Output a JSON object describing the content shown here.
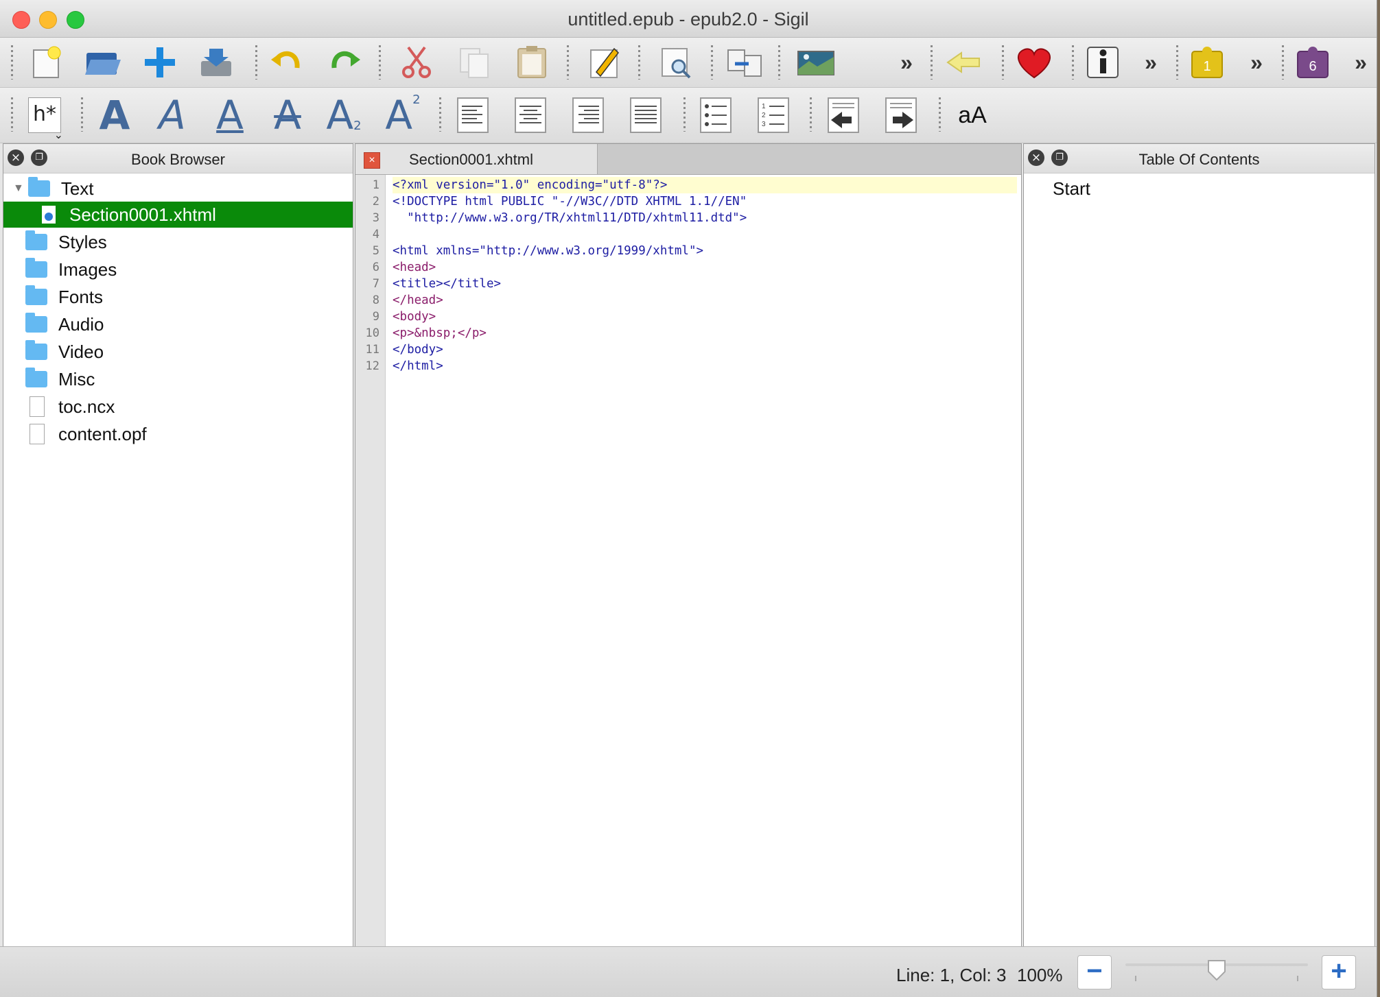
{
  "window": {
    "title": "untitled.epub - epub2.0 - Sigil"
  },
  "toolbar_main": {
    "icons": [
      "new-file-icon",
      "open-folder-icon",
      "add-plus-icon",
      "save-icon",
      "undo-icon",
      "redo-icon",
      "cut-icon",
      "copy-icon",
      "paste-icon",
      "edit-pencil-icon",
      "preview-icon",
      "split-merge-icon",
      "insert-image-icon",
      "more-icon",
      "back-arrow-icon",
      "heart-icon",
      "info-icon",
      "more-icon",
      "plugin-icon",
      "more-icon",
      "plugin-icon",
      "more-icon"
    ],
    "plugin1_badge": "1",
    "plugin2_badge": "6"
  },
  "toolbar_format": {
    "heading_label": "h*",
    "bold_label": "A",
    "italic_label": "A",
    "underline_label": "A",
    "strike_label": "A",
    "sub_label": "A",
    "sub_mark": "2",
    "sup_label": "A",
    "sup_mark": "2",
    "case_label": "aA"
  },
  "book_browser": {
    "title": "Book Browser",
    "items": [
      {
        "label": "Text",
        "kind": "folder"
      },
      {
        "label": "Section0001.xhtml",
        "kind": "html"
      },
      {
        "label": "Styles",
        "kind": "folder"
      },
      {
        "label": "Images",
        "kind": "folder"
      },
      {
        "label": "Fonts",
        "kind": "folder"
      },
      {
        "label": "Audio",
        "kind": "folder"
      },
      {
        "label": "Video",
        "kind": "folder"
      },
      {
        "label": "Misc",
        "kind": "folder"
      },
      {
        "label": "toc.ncx",
        "kind": "file"
      },
      {
        "label": "content.opf",
        "kind": "file"
      }
    ]
  },
  "editor": {
    "tab_label": "Section0001.xhtml",
    "line_numbers": [
      "1",
      "2",
      "3",
      "4",
      "5",
      "6",
      "7",
      "8",
      "9",
      "10",
      "11",
      "12"
    ],
    "lines": [
      "<?xml version=\"1.0\" encoding=\"utf-8\"?>",
      "<!DOCTYPE html PUBLIC \"-//W3C//DTD XHTML 1.1//EN\"",
      "  \"http://www.w3.org/TR/xhtml11/DTD/xhtml11.dtd\">",
      "",
      "<html xmlns=\"http://www.w3.org/1999/xhtml\">",
      "<head>",
      "<title></title>",
      "</head>",
      "<body>",
      "<p>&nbsp;</p>",
      "</body>",
      "</html>"
    ]
  },
  "toc": {
    "title": "Table Of Contents",
    "items": [
      "Start"
    ]
  },
  "status": {
    "position": "Line: 1, Col: 3",
    "zoom": "100%",
    "zoom_level": 0.5
  },
  "colors": {
    "selection": "#0a8a0a",
    "current_line": "#fffdd0"
  }
}
